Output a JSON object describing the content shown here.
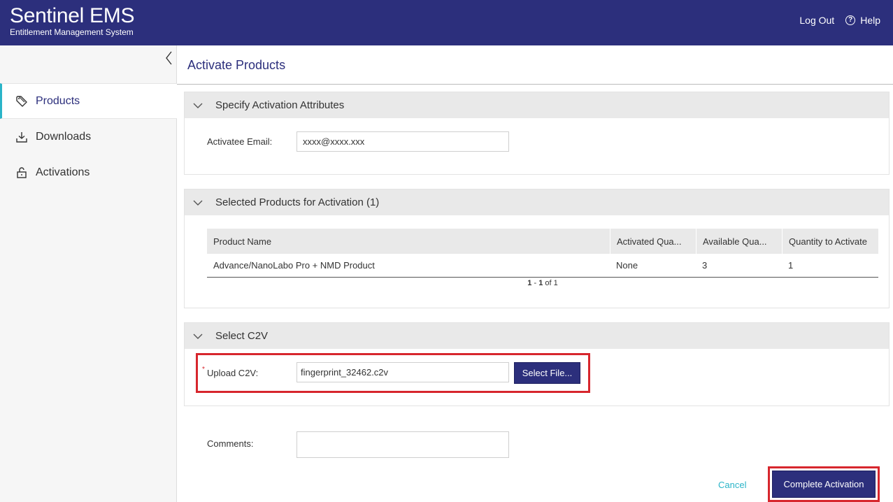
{
  "header": {
    "brand_title": "Sentinel EMS",
    "brand_subtitle": "Entitlement Management System",
    "logout_label": "Log Out",
    "help_label": "Help",
    "bg_color": "#2c2f7c"
  },
  "sidebar": {
    "items": [
      {
        "label": "Products",
        "icon": "tag-icon",
        "active": true
      },
      {
        "label": "Downloads",
        "icon": "download-icon",
        "active": false
      },
      {
        "label": "Activations",
        "icon": "unlock-icon",
        "active": false
      }
    ]
  },
  "main": {
    "title": "Activate Products",
    "attributes": {
      "heading": "Specify Activation Attributes",
      "email_label": "Activatee Email:",
      "email_value": "xxxx@xxxx.xxx"
    },
    "selected": {
      "heading": "Selected Products for Activation (1)",
      "columns": [
        "Product Name",
        "Activated Qua...",
        "Available Qua...",
        "Quantity to Activate"
      ],
      "rows": [
        [
          "Advance/NanoLabo Pro + NMD Product",
          "None",
          "3",
          "1"
        ]
      ],
      "pager": {
        "start": "1",
        "sep": " - ",
        "end": "1",
        "of": " of 1"
      }
    },
    "c2v": {
      "heading": "Select C2V",
      "required_mark": "*",
      "upload_label": "Upload C2V:",
      "file_value": "fingerprint_32462.c2v",
      "select_button": "Select File..."
    },
    "comments_label": "Comments:",
    "comments_value": "",
    "cancel_label": "Cancel",
    "complete_label": "Complete Activation",
    "accent_color": "#2ab4c8",
    "highlight_color": "#d7262d"
  }
}
